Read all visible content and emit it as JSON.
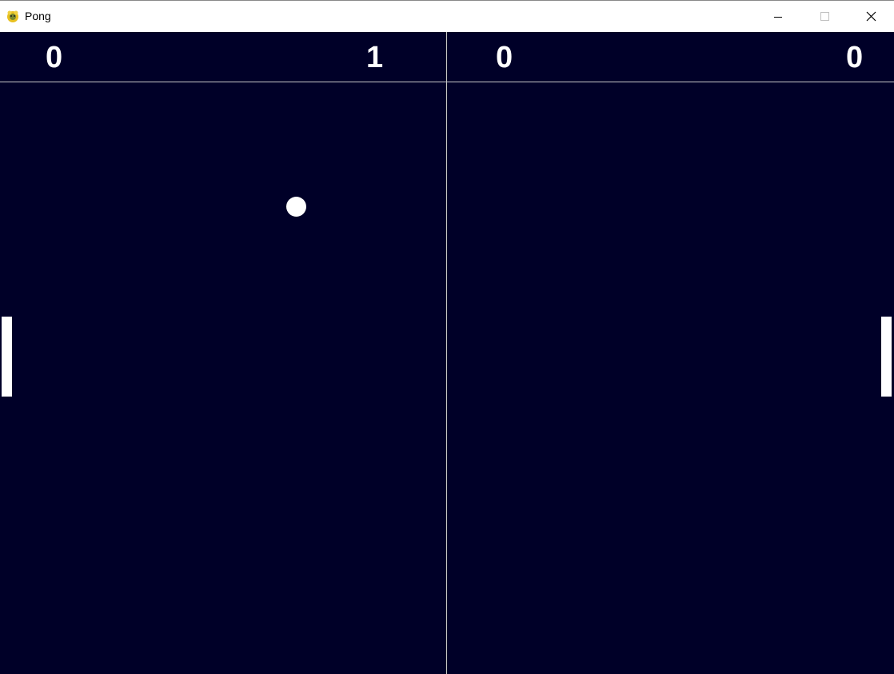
{
  "window": {
    "title": "Pong",
    "icon": "pygame-snake-icon",
    "controls": [
      "minimize-icon",
      "maximize-icon",
      "close-icon"
    ]
  },
  "game": {
    "background_color": "#000028",
    "line_color": "#c8c8c8",
    "foreground_color": "#ffffff",
    "scores": [
      "0",
      "1",
      "0",
      "0"
    ]
  }
}
